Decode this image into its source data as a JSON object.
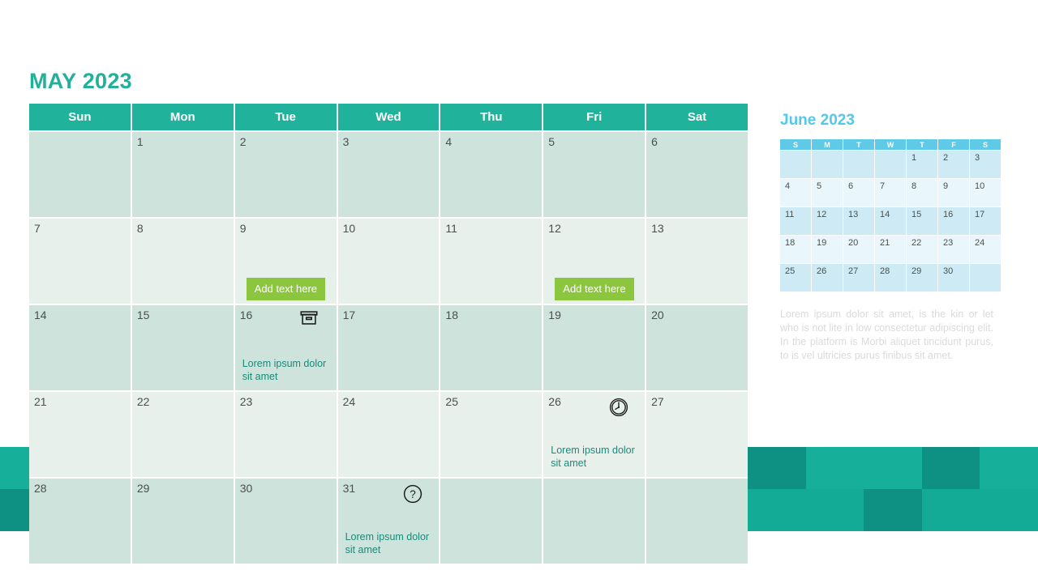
{
  "page_title": "MAY 2023",
  "theme": {
    "title_color": "#22b09a",
    "header_bg": "#20b29b",
    "row_dark": "#cee3dc",
    "row_light": "#e8f0ec",
    "event_text_color": "#1a8a78",
    "button_green": "#8cc63f",
    "mini_title_color": "#54c8e8",
    "mini_header_bg": "#5fc9e8",
    "mini_row_dark": "#cdeaf5",
    "mini_row_light": "#e9f6fb",
    "deco_teal": "#16b09a",
    "deco_teal_dark": "#0e9182"
  },
  "main_calendar": {
    "weekdays": [
      "Sun",
      "Mon",
      "Tue",
      "Wed",
      "Thu",
      "Fri",
      "Sat"
    ],
    "weeks": [
      {
        "shade": "dark",
        "days": [
          {
            "num": ""
          },
          {
            "num": "1"
          },
          {
            "num": "2"
          },
          {
            "num": "3"
          },
          {
            "num": "4"
          },
          {
            "num": "5"
          },
          {
            "num": "6"
          }
        ]
      },
      {
        "shade": "light",
        "days": [
          {
            "num": "7"
          },
          {
            "num": "8"
          },
          {
            "num": "9",
            "button": "Add text here"
          },
          {
            "num": "10"
          },
          {
            "num": "11"
          },
          {
            "num": "12",
            "button": "Add text here"
          },
          {
            "num": "13"
          }
        ]
      },
      {
        "shade": "dark",
        "days": [
          {
            "num": "14"
          },
          {
            "num": "15"
          },
          {
            "num": "16",
            "icon": "box-icon",
            "event": "Lorem ipsum dolor sit amet"
          },
          {
            "num": "17"
          },
          {
            "num": "18"
          },
          {
            "num": "19"
          },
          {
            "num": "20"
          }
        ]
      },
      {
        "shade": "light",
        "days": [
          {
            "num": "21"
          },
          {
            "num": "22"
          },
          {
            "num": "23"
          },
          {
            "num": "24"
          },
          {
            "num": "25"
          },
          {
            "num": "26",
            "icon": "clock-icon",
            "event": "Lorem ipsum dolor sit amet"
          },
          {
            "num": "27"
          }
        ]
      },
      {
        "shade": "dark",
        "days": [
          {
            "num": "28"
          },
          {
            "num": "29"
          },
          {
            "num": "30"
          },
          {
            "num": "31",
            "icon": "question-icon",
            "event": "Lorem ipsum dolor sit amet"
          },
          {
            "num": ""
          },
          {
            "num": ""
          },
          {
            "num": ""
          }
        ]
      }
    ]
  },
  "mini_calendar": {
    "title": "June 2023",
    "weekdays": [
      "S",
      "M",
      "T",
      "W",
      "T",
      "F",
      "S"
    ],
    "weeks": [
      {
        "shade": "dark",
        "days": [
          "",
          "",
          "",
          "",
          "1",
          "2",
          "3"
        ]
      },
      {
        "shade": "light",
        "days": [
          "4",
          "5",
          "6",
          "7",
          "8",
          "9",
          "10"
        ]
      },
      {
        "shade": "dark",
        "days": [
          "11",
          "12",
          "13",
          "14",
          "15",
          "16",
          "17"
        ]
      },
      {
        "shade": "light",
        "days": [
          "18",
          "19",
          "20",
          "21",
          "22",
          "23",
          "24"
        ]
      },
      {
        "shade": "dark",
        "days": [
          "25",
          "26",
          "27",
          "28",
          "29",
          "30",
          ""
        ]
      }
    ]
  },
  "side_body_text": "Lorem ipsum dolor sit amet, is the kin or let who is not lite   in low consectetur adipiscing elit. In the platform is Morbi aliquet tincidunt purus, to is vel ultricies purus finibus sit amet.",
  "decor": {
    "left_blocks": [
      "#16b09a",
      "#0e9182"
    ],
    "right_blocks": [
      "#0e9182",
      "#16b09a",
      "#16b09a",
      "#0e9182",
      "#16b09a",
      "#13ab96",
      "#13ab96",
      "#0e9182",
      "#13ab96",
      "#13ab96"
    ]
  }
}
